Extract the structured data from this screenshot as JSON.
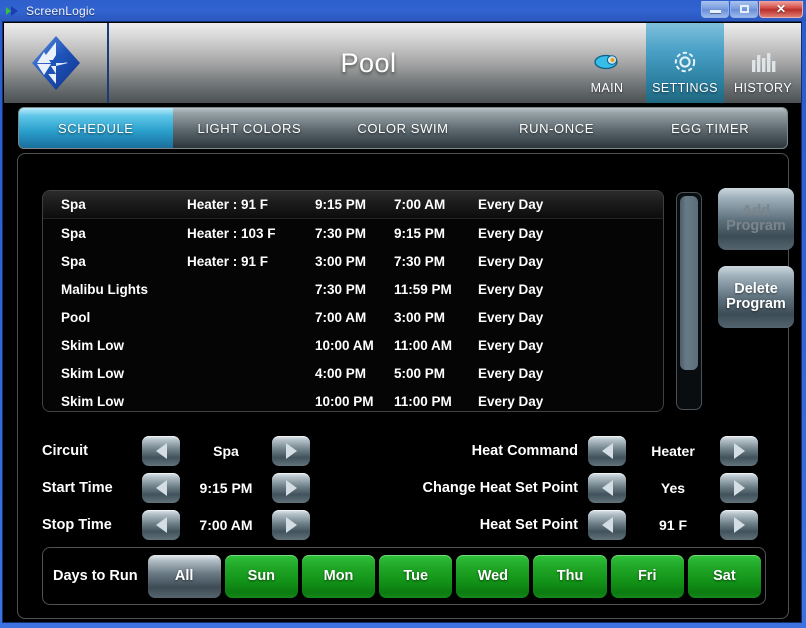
{
  "window": {
    "title": "ScreenLogic",
    "app_icon": "screenlogic-icon",
    "buttons": {
      "minimize": "minimize-icon",
      "maximize": "maximize-icon",
      "close": "✕"
    }
  },
  "header": {
    "logo": "pentair-diamond-logo",
    "title": "Pool",
    "nav": [
      {
        "label": "MAIN",
        "icon": "pool-icon",
        "active": false
      },
      {
        "label": "SETTINGS",
        "icon": "gear-icon",
        "active": true
      },
      {
        "label": "HISTORY",
        "icon": "bar-chart-icon",
        "active": false
      }
    ]
  },
  "tabs": [
    {
      "label": "SCHEDULE",
      "active": true
    },
    {
      "label": "LIGHT COLORS",
      "active": false
    },
    {
      "label": "COLOR SWIM",
      "active": false
    },
    {
      "label": "RUN-ONCE",
      "active": false
    },
    {
      "label": "EGG TIMER",
      "active": false
    }
  ],
  "schedule": {
    "columns": [
      "Circuit",
      "Heat Command",
      "Start Time",
      "Stop Time",
      "Days to Run"
    ],
    "rows": [
      {
        "circuit": "Spa",
        "heat": "Heater : 91 F",
        "start": "9:15  PM",
        "stop": "7:00  AM",
        "days": "Every Day",
        "selected": true
      },
      {
        "circuit": "Spa",
        "heat": "Heater : 103 F",
        "start": "7:30  PM",
        "stop": "9:15  PM",
        "days": "Every Day",
        "selected": false
      },
      {
        "circuit": "Spa",
        "heat": "Heater : 91 F",
        "start": "3:00  PM",
        "stop": "7:30  PM",
        "days": "Every Day",
        "selected": false
      },
      {
        "circuit": "Malibu Lights",
        "heat": "",
        "start": "7:30  PM",
        "stop": "11:59  PM",
        "days": "Every Day",
        "selected": false
      },
      {
        "circuit": "Pool",
        "heat": "",
        "start": "7:00  AM",
        "stop": "3:00  PM",
        "days": "Every Day",
        "selected": false
      },
      {
        "circuit": "Skim Low",
        "heat": "",
        "start": "10:00  AM",
        "stop": "11:00  AM",
        "days": "Every Day",
        "selected": false
      },
      {
        "circuit": "Skim Low",
        "heat": "",
        "start": "4:00  PM",
        "stop": "5:00  PM",
        "days": "Every Day",
        "selected": false
      },
      {
        "circuit": "Skim Low",
        "heat": "",
        "start": "10:00  PM",
        "stop": "11:00  PM",
        "days": "Every Day",
        "selected": false
      }
    ]
  },
  "side_buttons": {
    "add": "Add\nProgram",
    "add_line1": "Add",
    "add_line2": "Program",
    "add_enabled": false,
    "delete_line1": "Delete",
    "delete_line2": "Program",
    "delete_enabled": true
  },
  "editor": {
    "left": [
      {
        "label": "Circuit",
        "value": "Spa"
      },
      {
        "label": "Start Time",
        "value": "9:15  PM"
      },
      {
        "label": "Stop Time",
        "value": "7:00  AM"
      }
    ],
    "right": [
      {
        "label": "Heat Command",
        "value": "Heater"
      },
      {
        "label": "Change Heat Set Point",
        "value": "Yes"
      },
      {
        "label": "Heat Set Point",
        "value": "91 F"
      }
    ]
  },
  "days_to_run": {
    "label": "Days to Run",
    "buttons": [
      {
        "label": "All",
        "on": false
      },
      {
        "label": "Sun",
        "on": true
      },
      {
        "label": "Mon",
        "on": true
      },
      {
        "label": "Tue",
        "on": true
      },
      {
        "label": "Wed",
        "on": true
      },
      {
        "label": "Thu",
        "on": true
      },
      {
        "label": "Fri",
        "on": true
      },
      {
        "label": "Sat",
        "on": true
      }
    ]
  },
  "colors": {
    "accent_blue": "#2ca2ce",
    "active_green": "#23ab2b",
    "header_grey": "#a9a9a9",
    "titlebar_blue": "#2f62d2",
    "close_red": "#b9302a"
  }
}
